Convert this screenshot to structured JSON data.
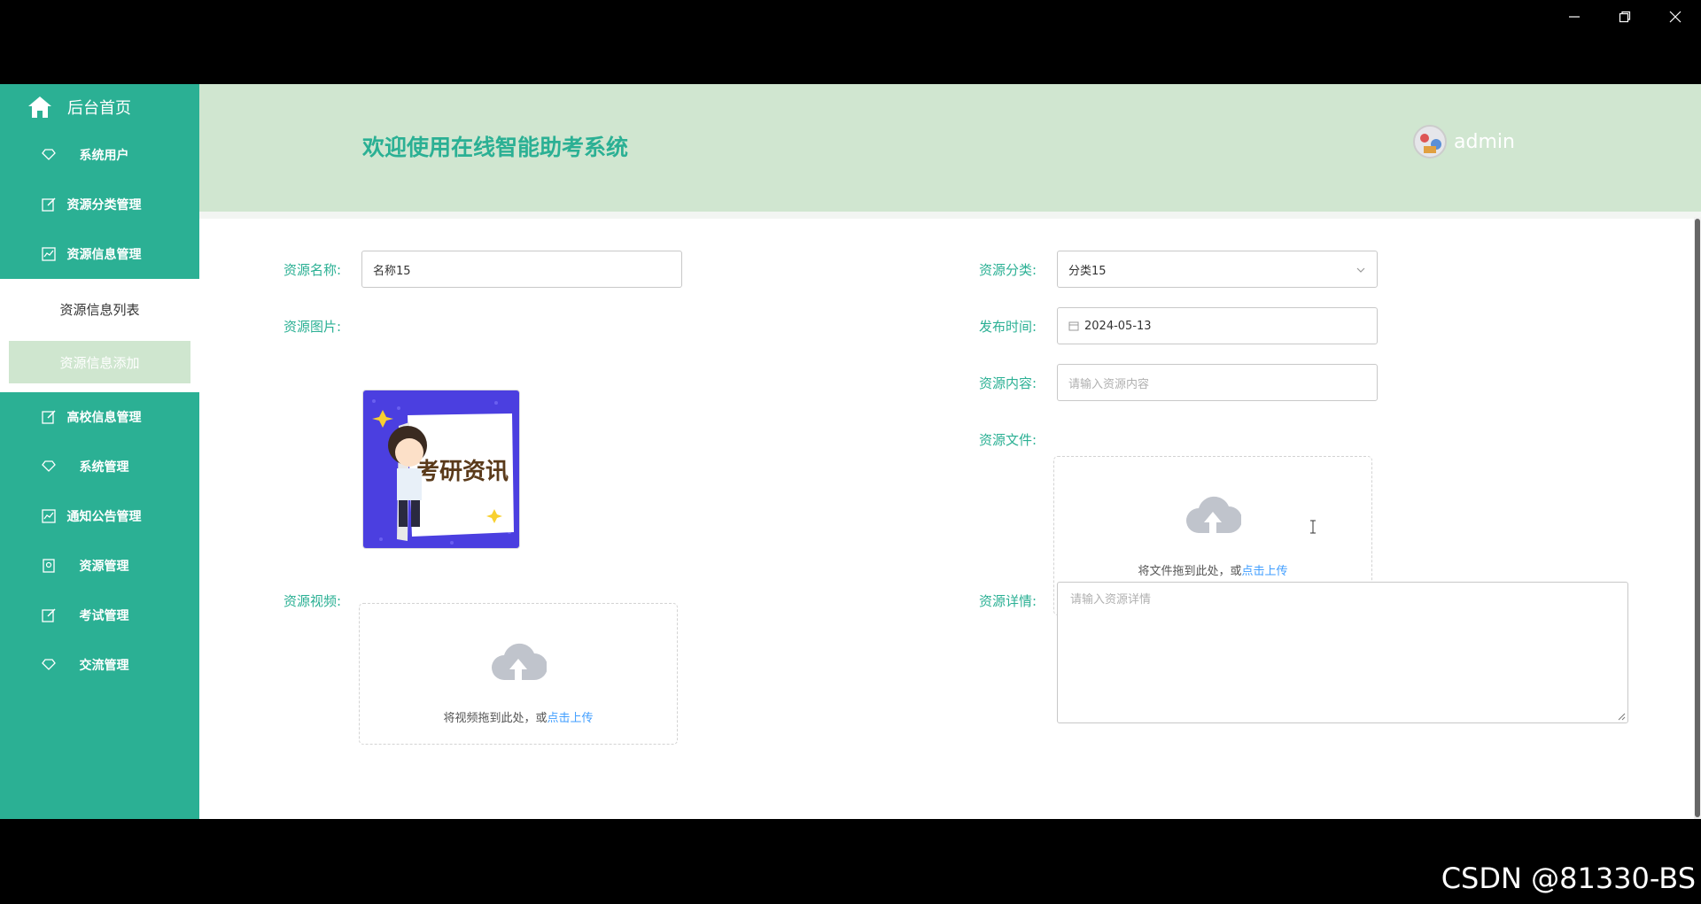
{
  "window": {
    "controls": [
      "minimize-icon",
      "restore-icon",
      "close-icon"
    ]
  },
  "sidebar": {
    "home_label": "后台首页",
    "items": [
      {
        "label": "系统用户",
        "icon": "diamond-icon"
      },
      {
        "label": "资源分类管理",
        "icon": "edit-icon"
      },
      {
        "label": "资源信息管理",
        "icon": "chart-icon"
      }
    ],
    "submenu": [
      {
        "label": "资源信息列表"
      },
      {
        "label": "资源信息添加"
      }
    ],
    "items_after": [
      {
        "label": "高校信息管理",
        "icon": "edit-icon"
      },
      {
        "label": "系统管理",
        "icon": "diamond-icon"
      },
      {
        "label": "通知公告管理",
        "icon": "chart-icon"
      },
      {
        "label": "资源管理",
        "icon": "badge-icon"
      },
      {
        "label": "考试管理",
        "icon": "edit-icon"
      },
      {
        "label": "交流管理",
        "icon": "diamond-icon"
      }
    ]
  },
  "header": {
    "title": "欢迎使用在线智能助考系统",
    "username": "admin"
  },
  "form": {
    "name_label": "资源名称:",
    "name_value": "名称15",
    "image_label": "资源图片:",
    "image_text": "考研资讯",
    "video_label": "资源视频:",
    "video_hint": "将视频拖到此处，或",
    "video_link": "点击上传",
    "category_label": "资源分类:",
    "category_value": "分类15",
    "date_label": "发布时间:",
    "date_value": "2024-05-13",
    "content_label": "资源内容:",
    "content_placeholder": "请输入资源内容",
    "file_label": "资源文件:",
    "file_hint": "将文件拖到此处，或",
    "file_link": "点击上传",
    "detail_label": "资源详情:",
    "detail_placeholder": "请输入资源详情"
  },
  "colors": {
    "accent": "#2bb094",
    "header_bg": "#d0e6d0",
    "link": "#409eff"
  },
  "watermark": "CSDN @81330-BS"
}
